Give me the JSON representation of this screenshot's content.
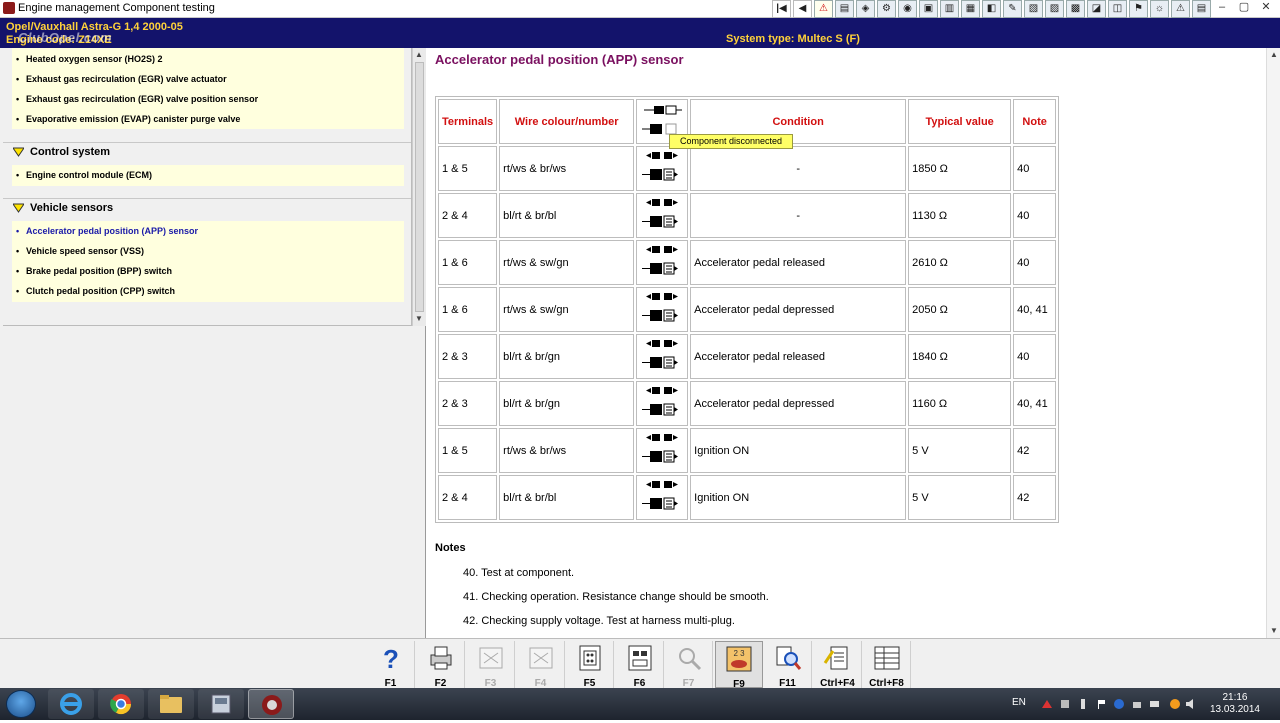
{
  "window": {
    "title": "Engine management Component testing",
    "watermark": "ClubOpel.com"
  },
  "vehicle": {
    "line1": "Opel/Vauxhall   Astra-G  1,4  2000-05",
    "line2": "Engine code: Z14XE",
    "system_type": "System type: Multec S (F)"
  },
  "sidebar": {
    "top_items": [
      "Heated oxygen sensor (HO2S) 2",
      "Exhaust gas recirculation (EGR) valve actuator",
      "Exhaust gas recirculation (EGR) valve position sensor",
      "Evaporative emission (EVAP) canister purge valve"
    ],
    "groups": [
      {
        "label": "Control system",
        "items": [
          "Engine control module (ECM)"
        ]
      },
      {
        "label": "Vehicle sensors",
        "items": [
          "Accelerator pedal position (APP) sensor",
          "Vehicle speed sensor (VSS)",
          "Brake pedal position (BPP) switch",
          "Clutch pedal position (CPP) switch"
        ]
      }
    ],
    "active_item": "Accelerator pedal position (APP) sensor"
  },
  "main": {
    "title": "Accelerator pedal position (APP) sensor",
    "tooltip": "Component disconnected",
    "headers": [
      "Terminals",
      "Wire colour/number",
      "",
      "Condition",
      "Typical value",
      "Note"
    ],
    "rows": [
      {
        "terminals": "1 & 5",
        "wire": "rt/ws & br/ws",
        "condition": "-",
        "value": "1850 Ω",
        "note": "40"
      },
      {
        "terminals": "2 & 4",
        "wire": "bl/rt & br/bl",
        "condition": "-",
        "value": "1130 Ω",
        "note": "40"
      },
      {
        "terminals": "1 & 6",
        "wire": "rt/ws & sw/gn",
        "condition": "Accelerator pedal released",
        "value": "2610 Ω",
        "note": "40"
      },
      {
        "terminals": "1 & 6",
        "wire": "rt/ws & sw/gn",
        "condition": "Accelerator pedal depressed",
        "value": "2050 Ω",
        "note": "40, 41"
      },
      {
        "terminals": "2 & 3",
        "wire": "bl/rt & br/gn",
        "condition": "Accelerator pedal released",
        "value": "1840 Ω",
        "note": "40"
      },
      {
        "terminals": "2 & 3",
        "wire": "bl/rt & br/gn",
        "condition": "Accelerator pedal depressed",
        "value": "1160 Ω",
        "note": "40, 41"
      },
      {
        "terminals": "1 & 5",
        "wire": "rt/ws & br/ws",
        "condition": "Ignition ON",
        "value": "5 V",
        "note": "42"
      },
      {
        "terminals": "2 & 4",
        "wire": "bl/rt & br/bl",
        "condition": "Ignition ON",
        "value": "5 V",
        "note": "42"
      }
    ],
    "notes_title": "Notes",
    "notes": [
      "40. Test at component.",
      "41. Checking operation. Resistance change should be smooth.",
      "42. Checking supply voltage. Test at harness multi-plug."
    ]
  },
  "fkeys": [
    {
      "label": "F1",
      "icon": "help-icon",
      "enabled": true
    },
    {
      "label": "F2",
      "icon": "printer-icon",
      "enabled": true
    },
    {
      "label": "F3",
      "icon": "diagram-icon",
      "enabled": false
    },
    {
      "label": "F4",
      "icon": "diagram-icon",
      "enabled": false
    },
    {
      "label": "F5",
      "icon": "pinout-icon",
      "enabled": true
    },
    {
      "label": "F6",
      "icon": "connector-icon",
      "enabled": true
    },
    {
      "label": "F7",
      "icon": "magnifier-icon",
      "enabled": false
    },
    {
      "label": "F9",
      "icon": "component-test-icon",
      "enabled": true,
      "pressed": true
    },
    {
      "label": "F11",
      "icon": "search-doc-icon",
      "enabled": true
    },
    {
      "label": "Ctrl+F4",
      "icon": "edit-doc-icon",
      "enabled": true
    },
    {
      "label": "Ctrl+F8",
      "icon": "table-icon",
      "enabled": true
    }
  ],
  "tray": {
    "lang": "EN",
    "time": "21:16",
    "date": "13.03.2014"
  },
  "colors": {
    "header_bg": "#13136b",
    "header_text": "#ffd23a",
    "title": "#7a1060",
    "table_header": "#d21010",
    "sidebar_bg": "#ffffde"
  }
}
